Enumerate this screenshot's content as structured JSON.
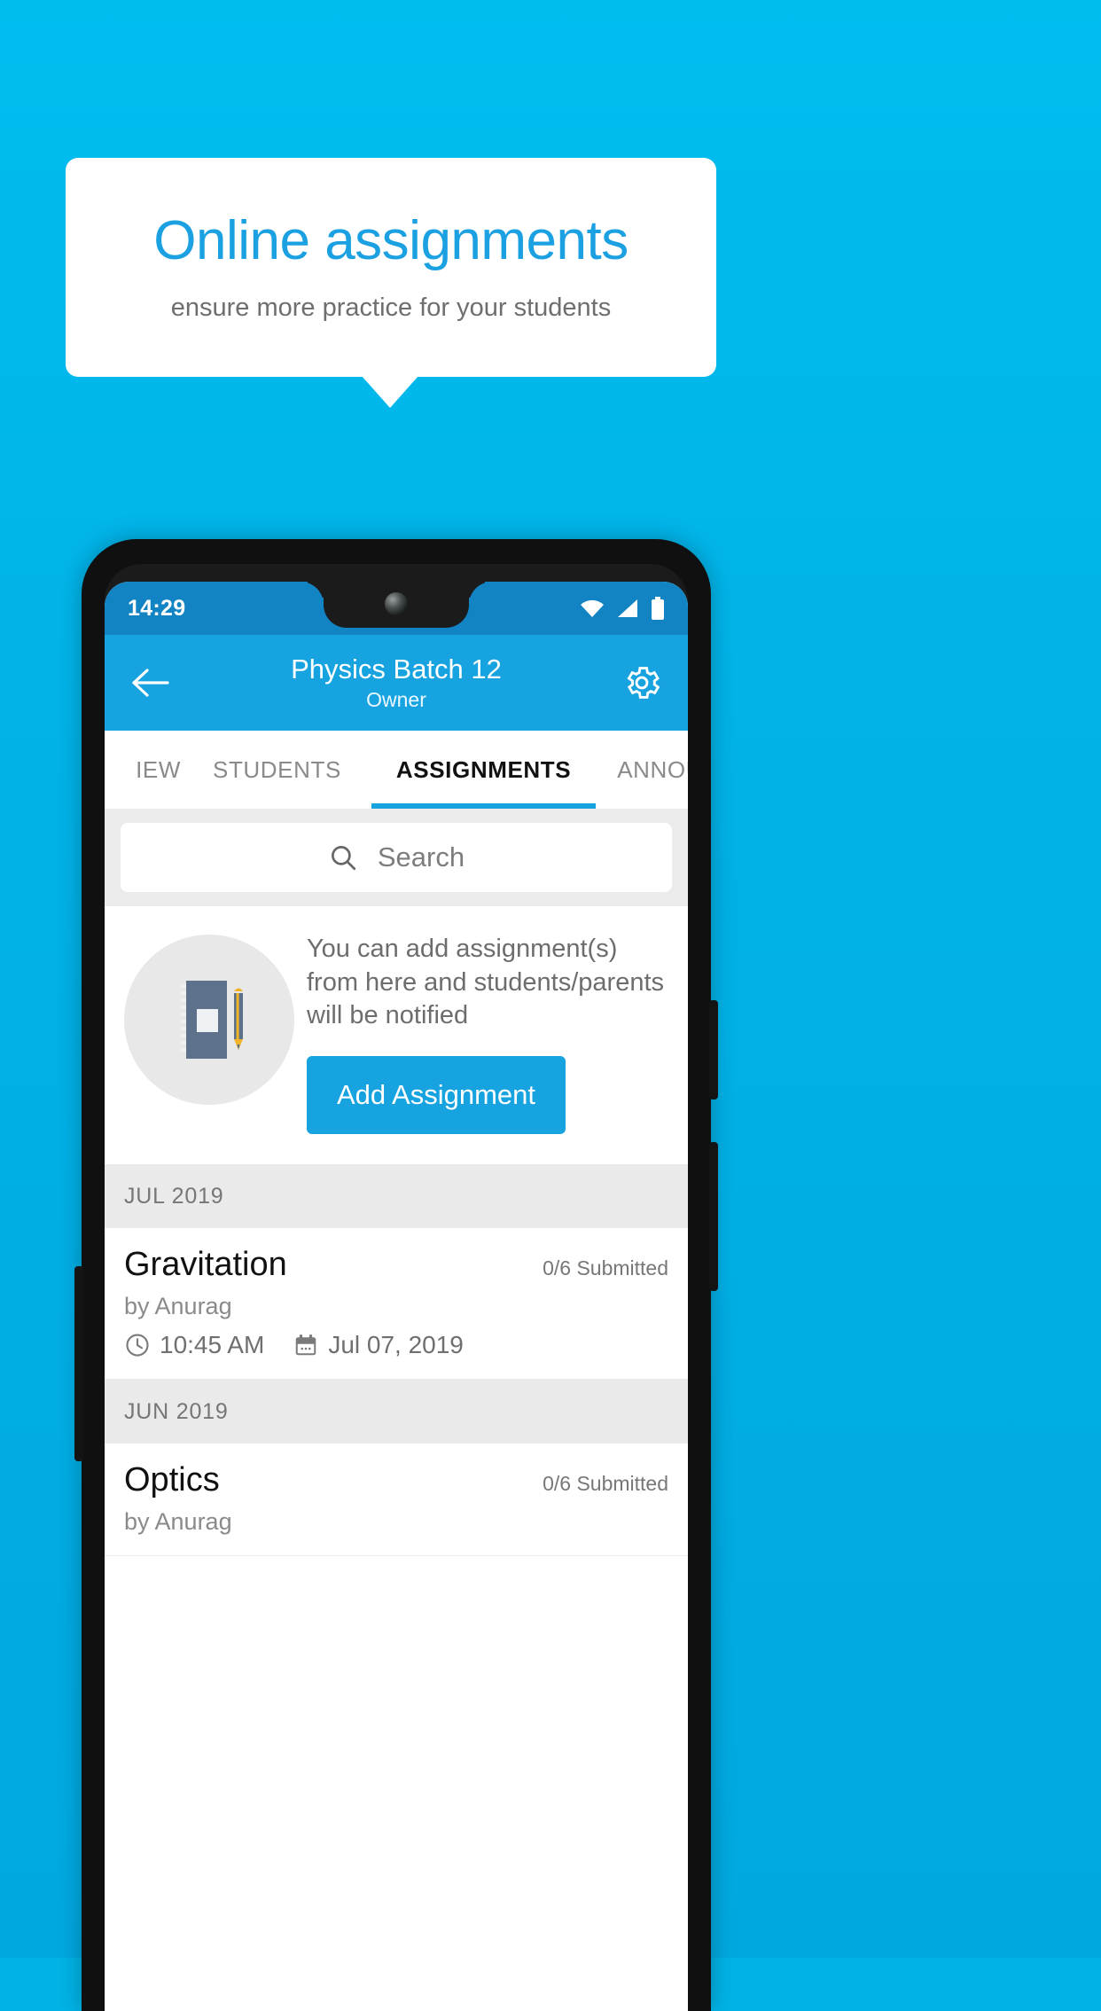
{
  "promo": {
    "title": "Online assignments",
    "subtitle": "ensure more practice for your students"
  },
  "colors": {
    "background": "#00b3e6",
    "brand_blue": "#17a3e0",
    "title_blue": "#1ba1e2",
    "statusbar_blue": "#1283c3",
    "band_gray": "#ebebeb",
    "month_gray": "#eaeaea"
  },
  "phone": {
    "statusbar": {
      "time": "14:29",
      "icons": [
        "wifi-icon",
        "signal-icon",
        "battery-icon"
      ]
    },
    "appbar": {
      "back_icon": "back-arrow-icon",
      "title": "Physics Batch 12",
      "subtitle": "Owner",
      "settings_icon": "gear-icon"
    },
    "tabs": [
      {
        "label": "IEW",
        "active": false
      },
      {
        "label": "STUDENTS",
        "active": false
      },
      {
        "label": "ASSIGNMENTS",
        "active": true
      },
      {
        "label": "ANNOUNCEM",
        "active": false
      }
    ],
    "search": {
      "icon": "search-icon",
      "placeholder": "Search",
      "value": ""
    },
    "empty_state": {
      "illustration": "notebook-and-pen-icon",
      "message": "You can add assignment(s) from here and students/parents will be notified",
      "button_label": "Add Assignment"
    },
    "sections": [
      {
        "month": "JUL 2019",
        "assignments": [
          {
            "title": "Gravitation",
            "submitted": "0/6 Submitted",
            "author": "by Anurag",
            "time_icon": "clock-icon",
            "time": "10:45 AM",
            "date_icon": "calendar-icon",
            "date": "Jul 07, 2019"
          }
        ]
      },
      {
        "month": "JUN 2019",
        "assignments": [
          {
            "title": "Optics",
            "submitted": "0/6 Submitted",
            "author": "by Anurag",
            "time_icon": "clock-icon",
            "time": "",
            "date_icon": "calendar-icon",
            "date": ""
          }
        ]
      }
    ]
  }
}
